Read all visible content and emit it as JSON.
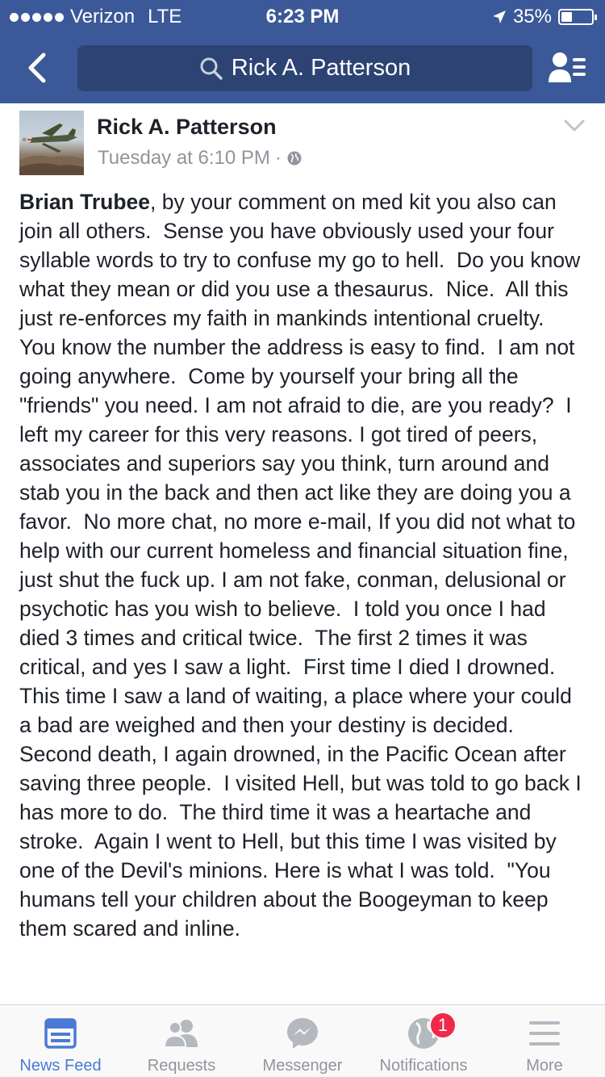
{
  "status_bar": {
    "carrier": "Verizon",
    "network": "LTE",
    "time": "6:23 PM",
    "battery_percent": "35%",
    "battery_level": 0.35
  },
  "nav": {
    "search_text": "Rick A. Patterson",
    "back_icon": "chevron-left-icon",
    "profile_icon": "profile-list-icon"
  },
  "post": {
    "author": "Rick A. Patterson",
    "timestamp": "Tuesday at 6:10 PM",
    "separator": "·",
    "mention": "Brian Trubee",
    "body": ", by your comment on med kit you also can join all others.  Sense you have obviously used your four syllable words to try to confuse my go to hell.  Do you know what they mean or did you use a thesaurus.  Nice.  All this just re-enforces my faith in mankinds intentional cruelty.  You know the number the address is easy to find.  I am not going anywhere.  Come by yourself your bring all the \"friends\" you need. I am not afraid to die, are you ready?  I left my career for this very reasons. I got tired of peers, associates and superiors say you think, turn around and stab you in the back and then act like they are doing you a favor.  No more chat, no more e-mail, If you did not what to help with our current homeless and financial situation fine, just shut the fuck up. I am not fake, conman, delusional or psychotic has you wish to believe.  I told you once I had died 3 times and critical twice.  The first 2 times it was critical, and yes I saw a light.  First time I died I drowned.  This time I saw a land of waiting, a place where your could a bad are weighed and then your destiny is decided.  Second death, I again drowned, in the Pacific Ocean after saving three people.  I visited Hell, but was told to go back I has more to do.  The third time it was a heartache and stroke.  Again I went to Hell, but this time I was visited by one of the Devil's minions. Here is what I was told.  \"You humans tell your children about the Boogeyman to keep them scared and inline."
  },
  "tabs": [
    {
      "label": "News Feed",
      "icon": "news-feed-icon",
      "active": true
    },
    {
      "label": "Requests",
      "icon": "friend-requests-icon",
      "active": false
    },
    {
      "label": "Messenger",
      "icon": "messenger-icon",
      "active": false
    },
    {
      "label": "Notifications",
      "icon": "globe-icon",
      "active": false,
      "badge": "1"
    },
    {
      "label": "More",
      "icon": "menu-icon",
      "active": false
    }
  ],
  "colors": {
    "brand": "#3b5998",
    "active_tab": "#4a7ad6",
    "badge": "#f02849"
  }
}
